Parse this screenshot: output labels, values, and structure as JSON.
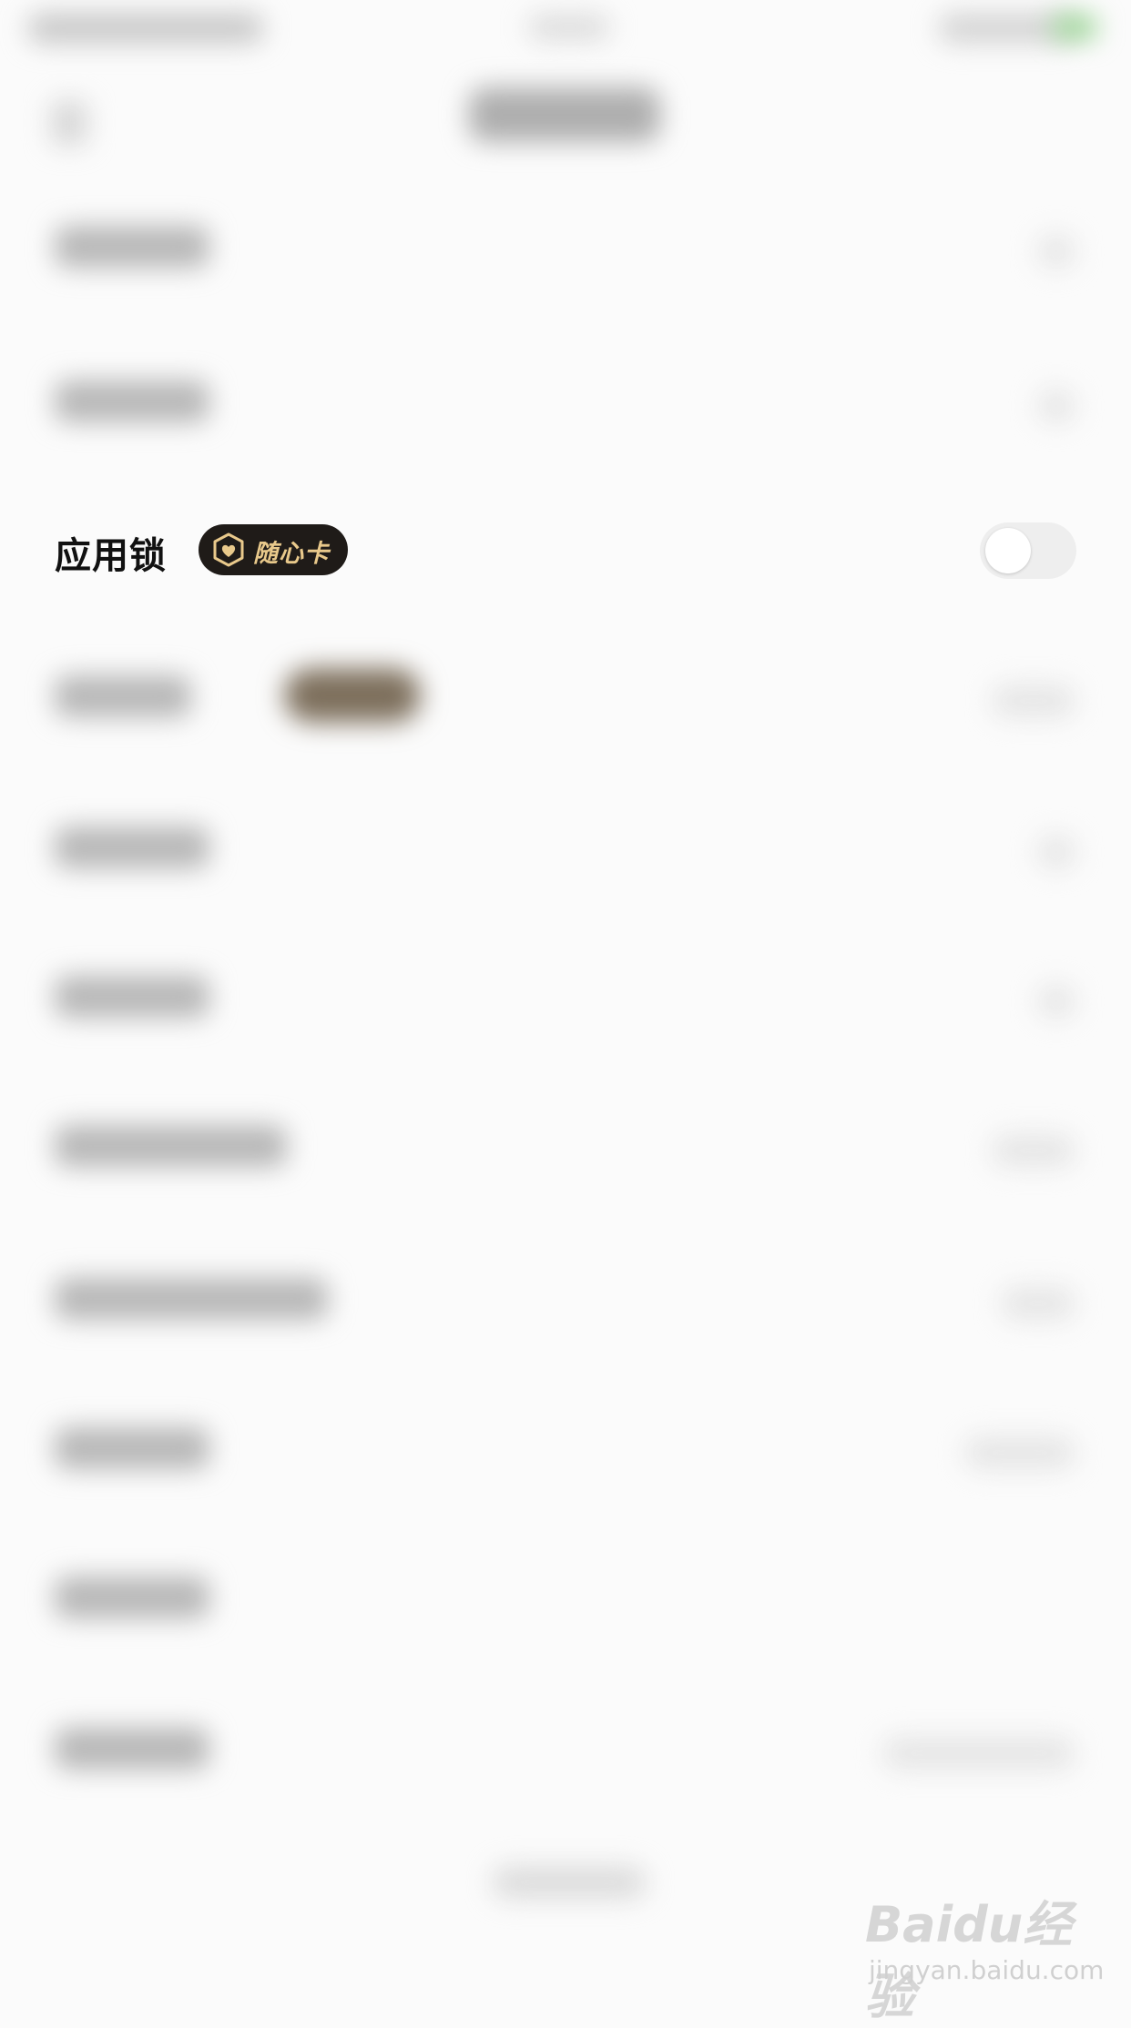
{
  "app_lock": {
    "label": "应用锁",
    "badge_text": "随心卡",
    "toggle_on": false
  },
  "watermark": {
    "logo_text": "Baidu经验",
    "url": "jingyan.baidu.com"
  }
}
